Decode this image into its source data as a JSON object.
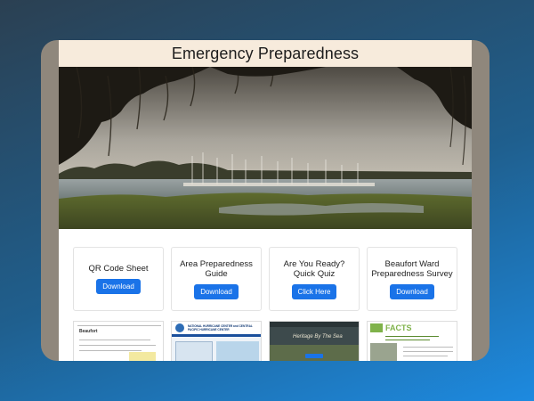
{
  "page": {
    "title": "Emergency Preparedness"
  },
  "cards": [
    {
      "title": "QR Code Sheet",
      "button": "Download"
    },
    {
      "title": "Area Preparedness Guide",
      "button": "Download"
    },
    {
      "title": "Are You Ready? Quick Quiz",
      "button": "Click Here"
    },
    {
      "title": "Beaufort Ward Preparedness Survey",
      "button": "Download"
    }
  ],
  "thumbnails": [
    {
      "heading": "Beaufort"
    },
    {
      "heading": "NATIONAL HURRICANE CENTER and CENTRAL PACIFIC HURRICANE CENTER"
    },
    {
      "heading": "Heritage By The Sea"
    },
    {
      "heading": "FACTS"
    }
  ],
  "colors": {
    "background_top": "#2b4052",
    "background_bottom": "#1d8ae0",
    "device_frame": "#8f877c",
    "header_bg": "#f7ebdc",
    "button": "#1a73e8"
  }
}
